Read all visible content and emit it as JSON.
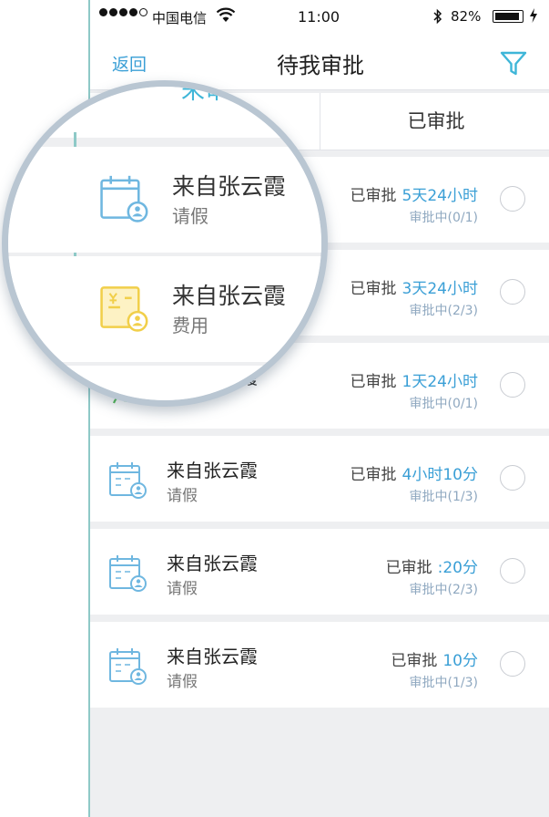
{
  "status_bar": {
    "carrier": "中国电信",
    "time": "11:00",
    "battery": "82%"
  },
  "nav": {
    "back_label": "返回",
    "title": "待我审批",
    "filter_icon": "filter-funnel-icon"
  },
  "tabs": {
    "pending_partial": "未审",
    "approved": "已审批"
  },
  "colors": {
    "accent": "#3a9fd6",
    "tab_accent": "#3fb6d8",
    "leave_icon": "#6fb7e0",
    "expense_icon": "#f1cf4a",
    "travel_icon": "#4bb84f"
  },
  "rows": [
    {
      "icon": "leave-calendar-icon",
      "sender": "来自张云霞",
      "type": "请假",
      "status_label": "已审批",
      "duration": "5天24小时",
      "progress": "审批中(0/1)"
    },
    {
      "icon": "expense-icon",
      "sender": "来自张云霞",
      "type": "费用",
      "status_label": "已审批",
      "duration": "3天24小时",
      "progress": "审批中(2/3)"
    },
    {
      "icon": "travel-icon",
      "sender": "来自张云霞",
      "type": "",
      "status_label": "已审批",
      "duration": "1天24小时",
      "progress": "审批中(0/1)"
    },
    {
      "icon": "leave-calendar-icon",
      "sender": "来自张云霞",
      "type": "请假",
      "status_label": "已审批",
      "duration": "4小时10分",
      "progress": "审批中(1/3)"
    },
    {
      "icon": "leave-calendar-icon",
      "sender": "来自张云霞",
      "type": "请假",
      "status_label": "已审批",
      "duration": ":20分",
      "progress": "审批中(2/3)"
    },
    {
      "icon": "leave-calendar-icon",
      "sender": "来自张云霞",
      "type": "请假",
      "status_label": "已审批",
      "duration": "10分",
      "progress": "审批中(1/3)"
    }
  ]
}
